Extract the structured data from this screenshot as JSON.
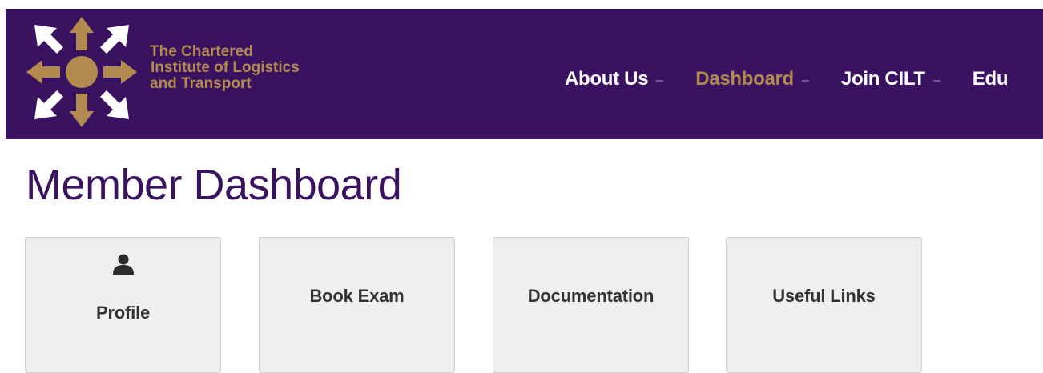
{
  "header": {
    "org_name_line1": "The Chartered",
    "org_name_line2": "Institute of Logistics",
    "org_name_line3": "and Transport",
    "logo_icon": "cilt-compass-logo",
    "background_color": "#391360",
    "accent_color": "#b28a4f"
  },
  "nav": {
    "items": [
      {
        "label": "About Us",
        "active": false
      },
      {
        "label": "Dashboard",
        "active": true
      },
      {
        "label": "Join CILT",
        "active": false
      },
      {
        "label": "Edu",
        "active": false
      }
    ]
  },
  "main": {
    "title": "Member Dashboard",
    "tiles": [
      {
        "label": "Profile",
        "icon": "user-icon"
      },
      {
        "label": "Book Exam"
      },
      {
        "label": "Documentation"
      },
      {
        "label": "Useful Links"
      }
    ]
  }
}
